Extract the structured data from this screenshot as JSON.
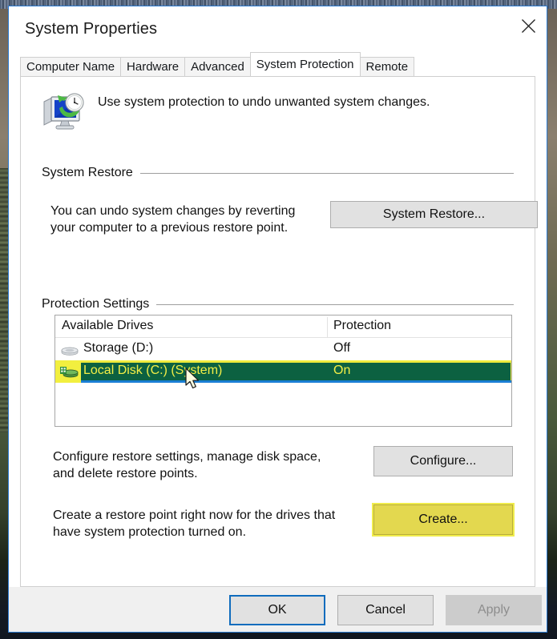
{
  "window": {
    "title": "System Properties",
    "close_icon": "close-icon"
  },
  "tabs": [
    {
      "label": "Computer Name",
      "active": false
    },
    {
      "label": "Hardware",
      "active": false
    },
    {
      "label": "Advanced",
      "active": false
    },
    {
      "label": "System Protection",
      "active": true
    },
    {
      "label": "Remote",
      "active": false
    }
  ],
  "header": {
    "icon": "system-protection-monitor-clock-icon",
    "description": "Use system protection to undo unwanted system changes."
  },
  "system_restore": {
    "group_label": "System Restore",
    "description_line1": "You can undo system changes by reverting",
    "description_line2": "your computer to a previous restore point.",
    "button_label": "System Restore..."
  },
  "protection_settings": {
    "group_label": "Protection Settings",
    "columns": {
      "drives": "Available Drives",
      "protection": "Protection"
    },
    "rows": [
      {
        "name": "Storage (D:)",
        "protection": "Off",
        "selected": false,
        "icon": "hard-drive-icon"
      },
      {
        "name": "Local Disk (C:) (System)",
        "protection": "On",
        "selected": true,
        "icon": "system-disk-icon"
      }
    ],
    "configure": {
      "description_line1": "Configure restore settings, manage disk space,",
      "description_line2": "and delete restore points.",
      "button_label": "Configure..."
    },
    "create": {
      "description_line1": "Create a restore point right now for the drives that",
      "description_line2": "have system protection turned on.",
      "button_label": "Create...",
      "highlighted": true
    }
  },
  "footer": {
    "ok_label": "OK",
    "cancel_label": "Cancel",
    "apply_label": "Apply",
    "apply_disabled": true
  },
  "colors": {
    "window_border": "#2b7ad1",
    "selection_green": "#0c6141",
    "selection_yellow": "#f2ef3f",
    "selection_blue": "#1a7fd4",
    "highlight_yellow": "#e3d84f",
    "focus_blue": "#0f6cbd",
    "button_face": "#e1e1e1",
    "disabled_text": "#8d8d8d"
  }
}
